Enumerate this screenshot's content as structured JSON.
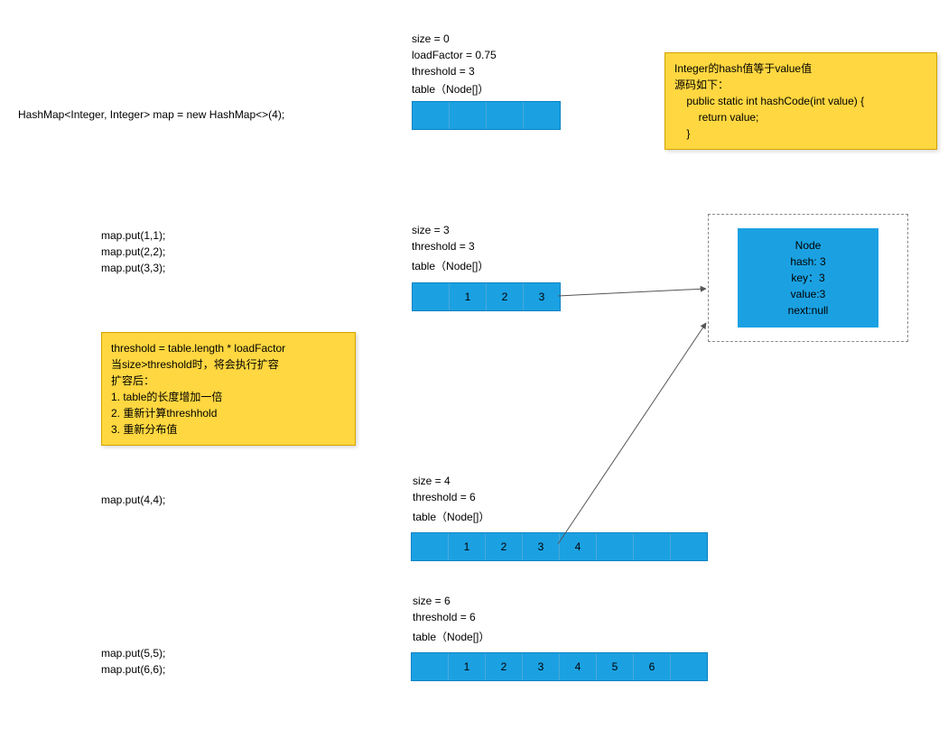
{
  "title_code": "HashMap<Integer, Integer> map = new HashMap<>(4);",
  "block1": {
    "l1": "size = 0",
    "l2": "loadFactor = 0.75",
    "l3": "threshold = 3",
    "l4": "table（Node[]）",
    "cells": [
      "",
      "",
      "",
      ""
    ]
  },
  "note_hash": "Integer的hash值等于value值\n源码如下：\n    public static int hashCode(int value) {\n        return value;\n    }",
  "put123": "map.put(1,1);\nmap.put(2,2);\nmap.put(3,3);",
  "block2": {
    "l1": "size = 3",
    "l2": "threshold = 3",
    "l3": "table（Node[]）",
    "cells": [
      "",
      "1",
      "2",
      "3"
    ]
  },
  "node_detail": "Node\nhash: 3\nkey：3\nvalue:3\nnext:null",
  "note_resize": "threshold = table.length * loadFactor\n当size>threshold时，将会执行扩容\n扩容后：\n1. table的长度增加一倍\n2. 重新计算threshhold\n3. 重新分布值",
  "put4": "map.put(4,4);",
  "block3": {
    "l1": "size = 4",
    "l2": "threshold = 6",
    "l3": "table（Node[]）",
    "cells": [
      "",
      "1",
      "2",
      "3",
      "4",
      "",
      "",
      ""
    ]
  },
  "put56": "map.put(5,5);\nmap.put(6,6);",
  "block4": {
    "l1": "size = 6",
    "l2": "threshold = 6",
    "l3": "table（Node[]）",
    "cells": [
      "",
      "1",
      "2",
      "3",
      "4",
      "5",
      "6",
      ""
    ]
  }
}
